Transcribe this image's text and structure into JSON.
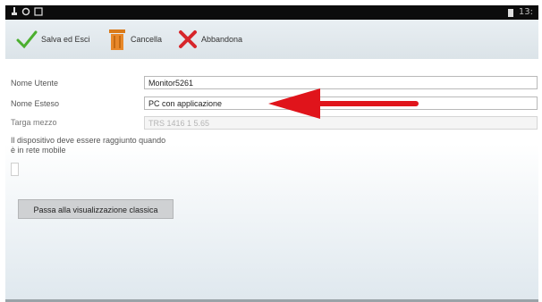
{
  "status_bar": {
    "left_icons": [
      "usb-icon",
      "refresh-icon",
      "image-icon"
    ],
    "time": "13:"
  },
  "toolbar": {
    "save_label": "Salva ed Esci",
    "delete_label": "Cancella",
    "abandon_label": "Abbandona"
  },
  "form": {
    "user_name_label": "Nome Utente",
    "user_name_value": "Monitor5261",
    "extended_name_label": "Nome Esteso",
    "extended_name_value": "PC con applicazione",
    "plate_label": "Targa mezzo",
    "plate_value": "TRS 1416 1 5.65",
    "device_note": "Il dispositivo deve essere raggiunto quando è in rete mobile"
  },
  "actions": {
    "classic_view_label": "Passa alla visualizzazione classica"
  },
  "annotation": {
    "arrow_color": "#e0141b"
  }
}
